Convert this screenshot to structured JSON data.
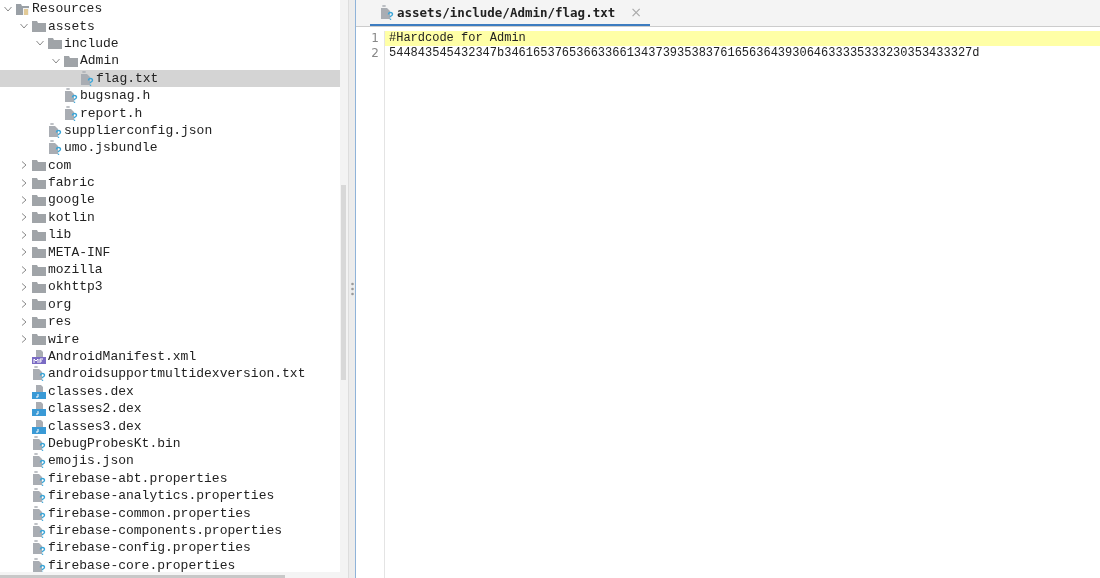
{
  "tree": {
    "label": "Resources",
    "kind": "root",
    "expanded": true,
    "selected": false,
    "children": [
      {
        "label": "assets",
        "kind": "folder",
        "expanded": true,
        "selected": false,
        "children": [
          {
            "label": "include",
            "kind": "folder",
            "expanded": true,
            "selected": false,
            "children": [
              {
                "label": "Admin",
                "kind": "folder",
                "expanded": true,
                "selected": false,
                "children": [
                  {
                    "label": "flag.txt",
                    "kind": "file",
                    "selected": true
                  }
                ]
              },
              {
                "label": "bugsnag.h",
                "kind": "file",
                "selected": false
              },
              {
                "label": "report.h",
                "kind": "file",
                "selected": false
              }
            ]
          },
          {
            "label": "supplierconfig.json",
            "kind": "file",
            "selected": false
          },
          {
            "label": "umo.jsbundle",
            "kind": "file",
            "selected": false
          }
        ]
      },
      {
        "label": "com",
        "kind": "folder",
        "expanded": false,
        "selected": false
      },
      {
        "label": "fabric",
        "kind": "folder",
        "expanded": false,
        "selected": false
      },
      {
        "label": "google",
        "kind": "folder",
        "expanded": false,
        "selected": false
      },
      {
        "label": "kotlin",
        "kind": "folder",
        "expanded": false,
        "selected": false
      },
      {
        "label": "lib",
        "kind": "folder",
        "expanded": false,
        "selected": false
      },
      {
        "label": "META-INF",
        "kind": "folder",
        "expanded": false,
        "selected": false
      },
      {
        "label": "mozilla",
        "kind": "folder",
        "expanded": false,
        "selected": false
      },
      {
        "label": "okhttp3",
        "kind": "folder",
        "expanded": false,
        "selected": false
      },
      {
        "label": "org",
        "kind": "folder",
        "expanded": false,
        "selected": false
      },
      {
        "label": "res",
        "kind": "folder",
        "expanded": false,
        "selected": false
      },
      {
        "label": "wire",
        "kind": "folder",
        "expanded": false,
        "selected": false
      },
      {
        "label": "AndroidManifest.xml",
        "kind": "manifest",
        "selected": false
      },
      {
        "label": "androidsupportmultidexversion.txt",
        "kind": "file",
        "selected": false
      },
      {
        "label": "classes.dex",
        "kind": "dex",
        "selected": false
      },
      {
        "label": "classes2.dex",
        "kind": "dex",
        "selected": false
      },
      {
        "label": "classes3.dex",
        "kind": "dex",
        "selected": false
      },
      {
        "label": "DebugProbesKt.bin",
        "kind": "file",
        "selected": false
      },
      {
        "label": "emojis.json",
        "kind": "file",
        "selected": false
      },
      {
        "label": "firebase-abt.properties",
        "kind": "file",
        "selected": false
      },
      {
        "label": "firebase-analytics.properties",
        "kind": "file",
        "selected": false
      },
      {
        "label": "firebase-common.properties",
        "kind": "file",
        "selected": false
      },
      {
        "label": "firebase-components.properties",
        "kind": "file",
        "selected": false
      },
      {
        "label": "firebase-config.properties",
        "kind": "file",
        "selected": false
      },
      {
        "label": "firebase-core.properties",
        "kind": "file",
        "selected": false
      }
    ]
  },
  "editor": {
    "tabs": [
      {
        "label": "assets/include/Admin/flag.txt",
        "close": "×",
        "selected": true
      }
    ],
    "lines": [
      {
        "number": "1",
        "text": "#Hardcode for Admin",
        "highlighted": true
      },
      {
        "number": "2",
        "text": "544843545432347b34616537653663366134373935383761656364393064633335333230353433327d",
        "highlighted": false
      }
    ]
  }
}
